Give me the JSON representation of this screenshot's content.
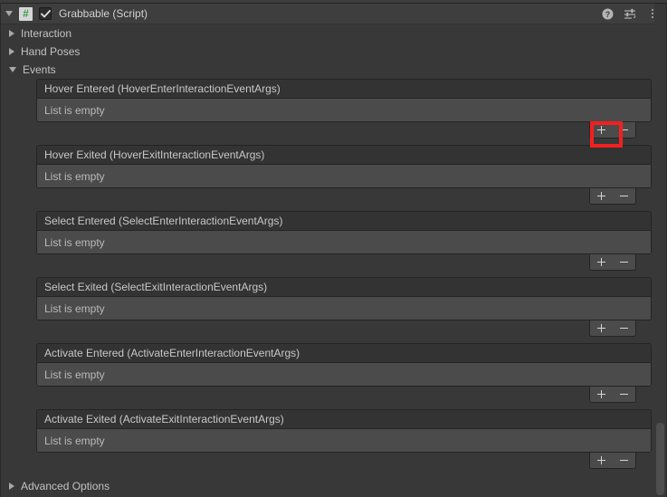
{
  "component": {
    "title": "Grabbable (Script)",
    "script_icon_glyph": "#",
    "enabled": true,
    "header_icons": [
      {
        "name": "help-icon",
        "glyph": "?"
      },
      {
        "name": "preset-icon",
        "glyph": "preset"
      },
      {
        "name": "kebab-menu-icon",
        "glyph": "⋮"
      }
    ]
  },
  "foldouts": [
    {
      "label": "Interaction",
      "expanded": false
    },
    {
      "label": "Hand Poses",
      "expanded": false
    },
    {
      "label": "Events",
      "expanded": true
    }
  ],
  "events": [
    {
      "title": "Hover Entered (HoverEnterInteractionEventArgs)",
      "empty_text": "List is empty",
      "add_label": "+",
      "remove_label": "-",
      "highlighted": true
    },
    {
      "title": "Hover Exited (HoverExitInteractionEventArgs)",
      "empty_text": "List is empty",
      "add_label": "+",
      "remove_label": "-",
      "highlighted": false
    },
    {
      "title": "Select Entered (SelectEnterInteractionEventArgs)",
      "empty_text": "List is empty",
      "add_label": "+",
      "remove_label": "-",
      "highlighted": false
    },
    {
      "title": "Select Exited (SelectExitInteractionEventArgs)",
      "empty_text": "List is empty",
      "add_label": "+",
      "remove_label": "-",
      "highlighted": false
    },
    {
      "title": "Activate Entered (ActivateEnterInteractionEventArgs)",
      "empty_text": "List is empty",
      "add_label": "+",
      "remove_label": "-",
      "highlighted": false
    },
    {
      "title": "Activate Exited (ActivateExitInteractionEventArgs)",
      "empty_text": "List is empty",
      "add_label": "+",
      "remove_label": "-",
      "highlighted": false
    }
  ],
  "advanced_options": {
    "label": "Advanced Options",
    "expanded": false
  },
  "colors": {
    "panel_background": "#383838",
    "header_background": "#3e3e3e",
    "event_title_background": "#333333",
    "event_body_background": "#4b4b4b",
    "border": "#242424",
    "text": "#c4c4c4",
    "script_icon_green": "#3c9e4e",
    "highlight_red": "#f32020"
  }
}
